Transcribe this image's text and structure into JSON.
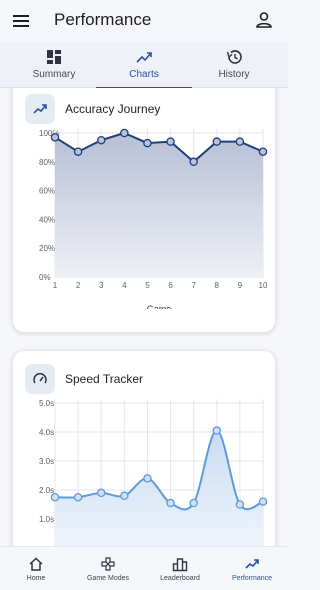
{
  "header": {
    "title": "Performance"
  },
  "tabs": [
    {
      "label": "Summary",
      "icon": "dashboard-icon"
    },
    {
      "label": "Charts",
      "icon": "trending-up-icon",
      "active": true
    },
    {
      "label": "History",
      "icon": "history-icon"
    }
  ],
  "cards": {
    "accuracy": {
      "title": "Accuracy Journey",
      "icon": "trending-up-icon"
    },
    "speed": {
      "title": "Speed Tracker",
      "icon": "speedometer-icon"
    }
  },
  "chart_data": [
    {
      "type": "area",
      "title": "Accuracy Journey",
      "xlabel": "Game",
      "ylabel": "",
      "x": [
        1,
        2,
        3,
        4,
        5,
        6,
        7,
        8,
        9,
        10
      ],
      "values": [
        97,
        87,
        95,
        100,
        93,
        94,
        80,
        94,
        94,
        87
      ],
      "ylim": [
        0,
        100
      ],
      "yticks": [
        "0%",
        "20%",
        "40%",
        "60%",
        "80%",
        "100%"
      ],
      "grid": true,
      "color": "#1f3f7a"
    },
    {
      "type": "area",
      "title": "Speed Tracker",
      "xlabel": "",
      "ylabel": "",
      "values": [
        1.75,
        1.75,
        1.9,
        1.8,
        2.4,
        1.55,
        1.55,
        4.05,
        1.5,
        1.6
      ],
      "ylim": [
        0,
        5
      ],
      "yticks": [
        "1.0s",
        "2.0s",
        "3.0s",
        "4.0s",
        "5.0s"
      ],
      "grid": true,
      "color": "#5e9ad8"
    }
  ],
  "bottom_nav": [
    {
      "label": "Home",
      "icon": "home-icon"
    },
    {
      "label": "Game Modes",
      "icon": "game-controller-icon"
    },
    {
      "label": "Leaderboard",
      "icon": "leaderboard-icon"
    },
    {
      "label": "Performance",
      "icon": "trending-up-icon",
      "active": true
    }
  ]
}
